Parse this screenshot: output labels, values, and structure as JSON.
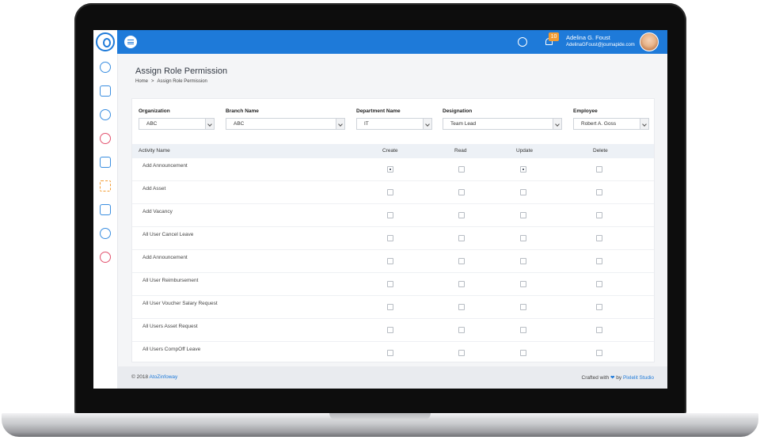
{
  "header": {
    "notification_count": "10",
    "user_name": "Adelina G. Foust",
    "user_email": "AdelinaGFoust@journapide.com"
  },
  "sidebar": {
    "icons": [
      "dashboard-icon",
      "calendar-icon",
      "users-icon",
      "handshake-icon",
      "document-icon",
      "team-icon",
      "transfer-icon",
      "chat-icon",
      "support-icon"
    ]
  },
  "page": {
    "title": "Assign Role Permission",
    "breadcrumb": {
      "home": "Home",
      "separator": ">",
      "current": "Assign Role Permission"
    }
  },
  "filters": [
    {
      "label": "Organization",
      "value": "ABC"
    },
    {
      "label": "Branch Name",
      "value": "ABC"
    },
    {
      "label": "Department Name",
      "value": "IT"
    },
    {
      "label": "Designation",
      "value": "Team Lead"
    },
    {
      "label": "Employee",
      "value": "Robert A. Goss"
    }
  ],
  "table": {
    "headers": {
      "activity": "Activity Name",
      "create": "Create",
      "read": "Read",
      "update": "Update",
      "delete": "Delete"
    },
    "rows": [
      {
        "name": "Add Announcement",
        "create": true,
        "read": false,
        "update": true,
        "delete": false
      },
      {
        "name": "Add Asset",
        "create": false,
        "read": false,
        "update": false,
        "delete": false
      },
      {
        "name": "Add Vacancy",
        "create": false,
        "read": false,
        "update": false,
        "delete": false
      },
      {
        "name": "All User Cancel Leave",
        "create": false,
        "read": false,
        "update": false,
        "delete": false
      },
      {
        "name": "Add Announcement",
        "create": false,
        "read": false,
        "update": false,
        "delete": false
      },
      {
        "name": "All User Reimbursement",
        "create": false,
        "read": false,
        "update": false,
        "delete": false
      },
      {
        "name": "All User Voucher Salary Request",
        "create": false,
        "read": false,
        "update": false,
        "delete": false
      },
      {
        "name": "All Users Asset Request",
        "create": false,
        "read": false,
        "update": false,
        "delete": false
      },
      {
        "name": "All Users CompOff Leave",
        "create": false,
        "read": false,
        "update": false,
        "delete": false
      }
    ]
  },
  "footer": {
    "copyright_prefix": "© 2018",
    "copyright_link": "AtoZinfoway",
    "crafted_prefix": "Crafted with",
    "crafted_by": "by",
    "crafted_link": "Pixlelit Studio"
  },
  "colors": {
    "primary": "#1e7ad9",
    "badge": "#f39c33",
    "accent_red": "#e2526e"
  }
}
